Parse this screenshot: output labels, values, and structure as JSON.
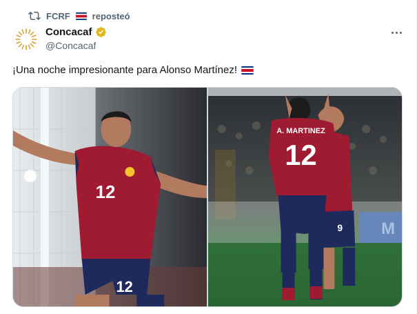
{
  "repost": {
    "icon": "repost-icon",
    "account": "FCRF",
    "flag": "costa-rica-flag",
    "label": "reposteó"
  },
  "author": {
    "name": "Concacaf",
    "handle": "@Concacaf",
    "verified_badge": "gold-verified-badge-icon",
    "avatar": "concacaf-logo"
  },
  "tweet": {
    "text": "¡Una noche impresionante para Alonso Martínez!",
    "flag": "costa-rica-flag"
  },
  "menu": {
    "icon": "more-icon"
  },
  "media": {
    "photos": [
      {
        "description_icon": "photo-celebration",
        "jersey_number": "12"
      },
      {
        "description_icon": "photo-embrace",
        "jersey_name": "A. MARTINEZ",
        "jersey_number": "12",
        "teammate_number": "9"
      }
    ]
  },
  "colors": {
    "text_primary": "#0f1419",
    "text_secondary": "#536471",
    "verified_gold": "#e2b719",
    "jersey_red": "#9e1b32",
    "shorts_navy": "#1f2a5c",
    "pitch_green": "#2f6f3a"
  }
}
